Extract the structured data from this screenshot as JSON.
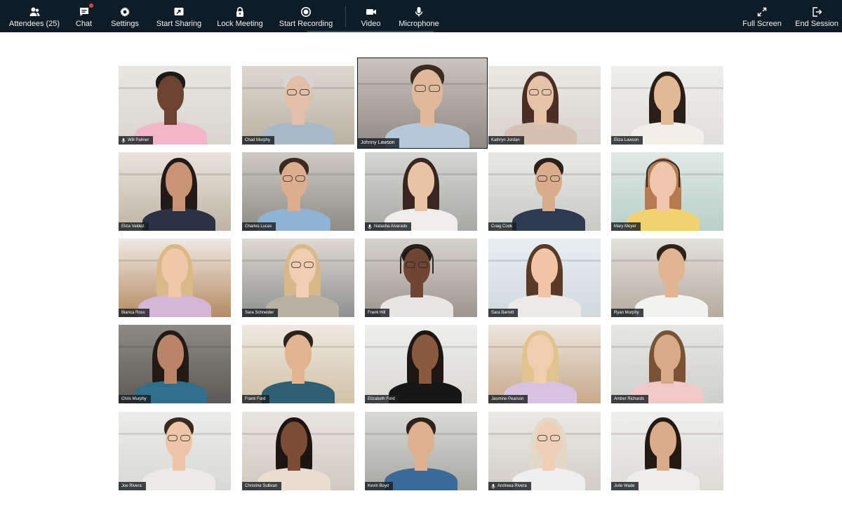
{
  "toolbar": {
    "left": [
      {
        "label": "Attendees (25)",
        "icon": "attendees-icon"
      },
      {
        "label": "Chat",
        "icon": "chat-icon",
        "notification": true
      },
      {
        "label": "Settings",
        "icon": "gear-icon"
      },
      {
        "label": "Start Sharing",
        "icon": "share-screen-icon"
      },
      {
        "label": "Lock Meeting",
        "icon": "lock-icon"
      },
      {
        "label": "Start Recording",
        "icon": "record-icon"
      },
      {
        "label": "Video",
        "icon": "video-camera-icon"
      },
      {
        "label": "Microphone",
        "icon": "microphone-icon"
      }
    ],
    "right": [
      {
        "label": "Full Screen",
        "icon": "expand-icon"
      },
      {
        "label": "End Session",
        "icon": "exit-icon"
      }
    ]
  },
  "colors": {
    "toolbar_bg": "#0d1c26",
    "notification_dot": "#e4433a",
    "page_bg": "#ffffff"
  },
  "participants": [
    {
      "name": "Will Palmer",
      "mic": true
    },
    {
      "name": "Chad Murphy",
      "mic": false
    },
    {
      "name": "Johnny Lawson",
      "mic": false,
      "featured": true
    },
    {
      "name": "Kathryn Jordan",
      "mic": false
    },
    {
      "name": "Eliza Lawson",
      "mic": false
    },
    {
      "name": "Eliza Valdez",
      "mic": false
    },
    {
      "name": "Charles Lucas",
      "mic": false
    },
    {
      "name": "Natasha Alvarado",
      "mic": true
    },
    {
      "name": "Craig Cook",
      "mic": false
    },
    {
      "name": "Mary Meyer",
      "mic": false
    },
    {
      "name": "Bianca Ross",
      "mic": false
    },
    {
      "name": "Sara Schneider",
      "mic": false
    },
    {
      "name": "Frank Hill",
      "mic": false
    },
    {
      "name": "Sara Barrett",
      "mic": false
    },
    {
      "name": "Ryan Murphy",
      "mic": false
    },
    {
      "name": "Chris Murphy",
      "mic": false
    },
    {
      "name": "Frank Ford",
      "mic": false
    },
    {
      "name": "Elizabeth Ford",
      "mic": false
    },
    {
      "name": "Jasmine Pearson",
      "mic": false
    },
    {
      "name": "Amber Richards",
      "mic": false
    },
    {
      "name": "Joe Rivera",
      "mic": false
    },
    {
      "name": "Christine Sullivan",
      "mic": false
    },
    {
      "name": "Kevin Boyd",
      "mic": false
    },
    {
      "name": "Andreea Rivera",
      "mic": true
    },
    {
      "name": "Julie Wade",
      "mic": false
    }
  ]
}
